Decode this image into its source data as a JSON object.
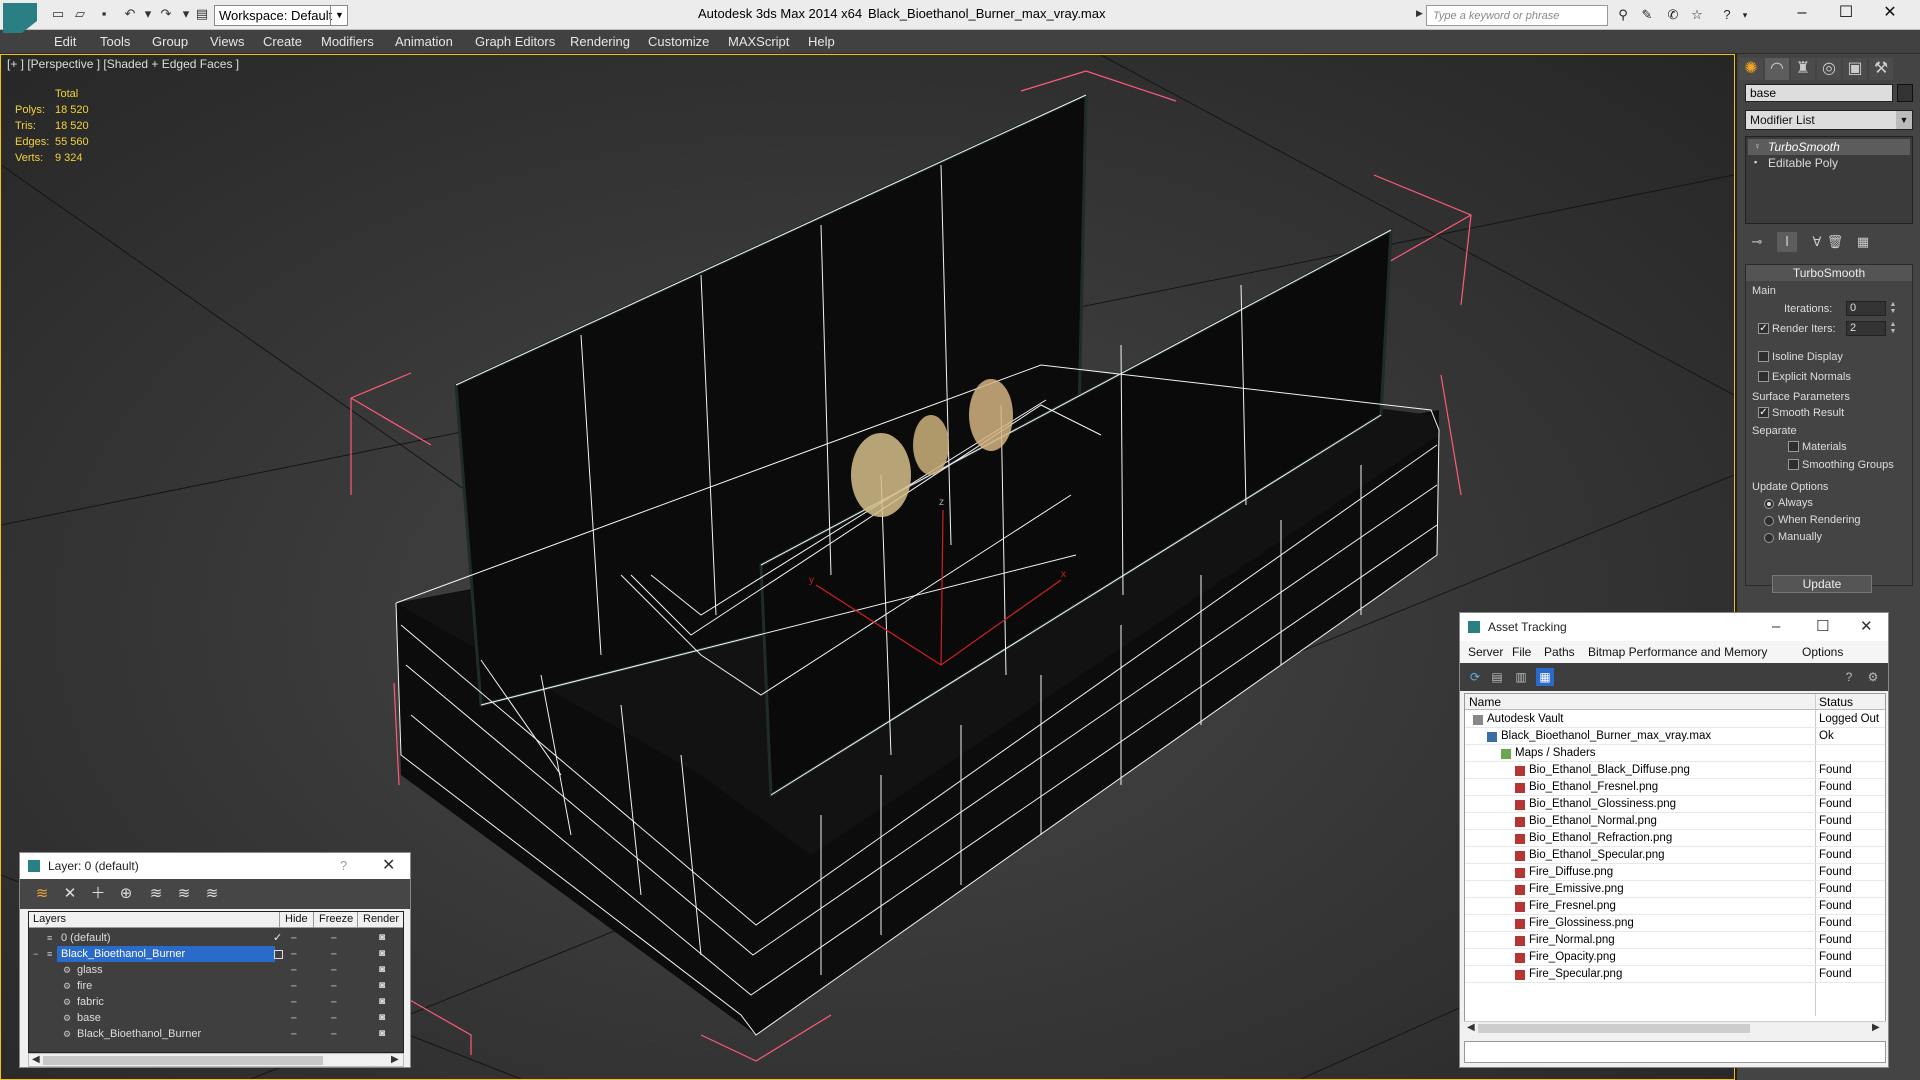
{
  "titlebar": {
    "app_title": "Autodesk 3ds Max  2014 x64",
    "file_title": "Black_Bioethanol_Burner_max_vray.max",
    "workspace_label": "Workspace: Default",
    "search_placeholder": "Type a keyword or phrase",
    "window_buttons": [
      "minimize-icon",
      "maximize-icon",
      "close-icon"
    ]
  },
  "menubar": {
    "items": [
      "Edit",
      "Tools",
      "Group",
      "Views",
      "Create",
      "Modifiers",
      "Animation",
      "Graph Editors",
      "Rendering",
      "Customize",
      "MAXScript",
      "Help"
    ]
  },
  "viewport": {
    "label": "[+ ] [Perspective ] [Shaded + Edged Faces ]",
    "stats": {
      "header": "Total",
      "rows": [
        {
          "label": "Polys:",
          "value": "18 520"
        },
        {
          "label": "Tris:",
          "value": "18 520"
        },
        {
          "label": "Edges:",
          "value": "55 560"
        },
        {
          "label": "Verts:",
          "value": "9 324"
        }
      ]
    },
    "gizmo": {
      "x": "x",
      "y": "y",
      "z": "z"
    },
    "colors": {
      "border": "#f0c400",
      "stats": "#f0d23c",
      "wireframe": "#ffffff",
      "bbox": "#ff5a7a",
      "gizmo": "#d02020"
    }
  },
  "command_panel": {
    "tabs": [
      "create-icon",
      "modify-icon",
      "hierarchy-icon",
      "motion-icon",
      "display-icon",
      "utilities-icon"
    ],
    "object_name": "base",
    "modifier_list": "Modifier List",
    "stack": [
      {
        "label": "TurboSmooth"
      },
      {
        "label": "Editable Poly"
      }
    ],
    "rollout": {
      "title": "TurboSmooth",
      "main_group": "Main",
      "iterations_label": "Iterations:",
      "iterations_value": "0",
      "render_iters_label": "Render Iters:",
      "render_iters_value": "2",
      "isoline_label": "Isoline Display",
      "explicit_normals_label": "Explicit Normals",
      "surface_group": "Surface Parameters",
      "smooth_result_label": "Smooth Result",
      "separate_label": "Separate",
      "materials_label": "Materials",
      "smoothing_groups_label": "Smoothing Groups",
      "update_group": "Update Options",
      "always_label": "Always",
      "when_rendering_label": "When Rendering",
      "manually_label": "Manually",
      "update_button": "Update"
    }
  },
  "layer_window": {
    "title": "Layer: 0 (default)",
    "help": "?",
    "columns": [
      "Layers",
      "Hide",
      "Freeze",
      "Render"
    ],
    "rows": [
      {
        "name": "0 (default)",
        "level": 0,
        "check": "✓"
      },
      {
        "name": "Black_Bioethanol_Burner",
        "level": 0,
        "selected": true
      },
      {
        "name": "glass",
        "level": 1
      },
      {
        "name": "fire",
        "level": 1
      },
      {
        "name": "fabric",
        "level": 1
      },
      {
        "name": "base",
        "level": 1
      },
      {
        "name": "Black_Bioethanol_Burner",
        "level": 1
      }
    ]
  },
  "asset_window": {
    "title": "Asset Tracking",
    "menu": [
      "Server",
      "File",
      "Paths",
      "Bitmap Performance and Memory",
      "Options"
    ],
    "columns": [
      "Name",
      "Status"
    ],
    "rows": [
      {
        "name": "Autodesk Vault",
        "status": "Logged Out",
        "level": 0,
        "icon": "vault"
      },
      {
        "name": "Black_Bioethanol_Burner_max_vray.max",
        "status": "Ok",
        "level": 1,
        "icon": "maxf"
      },
      {
        "name": "Maps / Shaders",
        "status": "",
        "level": 2,
        "icon": "folder"
      },
      {
        "name": "Bio_Ethanol_Black_Diffuse.png",
        "status": "Found",
        "level": 3,
        "icon": "png"
      },
      {
        "name": "Bio_Ethanol_Fresnel.png",
        "status": "Found",
        "level": 3,
        "icon": "png"
      },
      {
        "name": "Bio_Ethanol_Glossiness.png",
        "status": "Found",
        "level": 3,
        "icon": "png"
      },
      {
        "name": "Bio_Ethanol_Normal.png",
        "status": "Found",
        "level": 3,
        "icon": "png"
      },
      {
        "name": "Bio_Ethanol_Refraction.png",
        "status": "Found",
        "level": 3,
        "icon": "png"
      },
      {
        "name": "Bio_Ethanol_Specular.png",
        "status": "Found",
        "level": 3,
        "icon": "png"
      },
      {
        "name": "Fire_Diffuse.png",
        "status": "Found",
        "level": 3,
        "icon": "png"
      },
      {
        "name": "Fire_Emissive.png",
        "status": "Found",
        "level": 3,
        "icon": "png"
      },
      {
        "name": "Fire_Fresnel.png",
        "status": "Found",
        "level": 3,
        "icon": "png"
      },
      {
        "name": "Fire_Glossiness.png",
        "status": "Found",
        "level": 3,
        "icon": "png"
      },
      {
        "name": "Fire_Normal.png",
        "status": "Found",
        "level": 3,
        "icon": "png"
      },
      {
        "name": "Fire_Opacity.png",
        "status": "Found",
        "level": 3,
        "icon": "png"
      },
      {
        "name": "Fire_Specular.png",
        "status": "Found",
        "level": 3,
        "icon": "png"
      }
    ]
  }
}
